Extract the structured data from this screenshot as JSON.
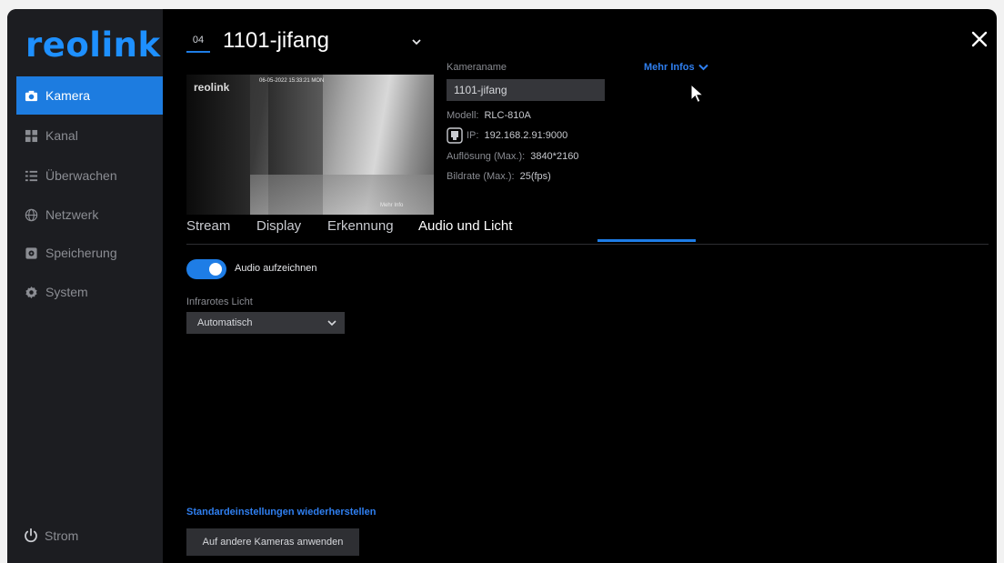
{
  "sidebar": {
    "logo": "reolink",
    "items": [
      {
        "label": "Kamera",
        "icon": "camera-icon",
        "active": true
      },
      {
        "label": "Kanal",
        "icon": "grid-icon"
      },
      {
        "label": "Überwachen",
        "icon": "list-icon"
      },
      {
        "label": "Netzwerk",
        "icon": "globe-icon"
      },
      {
        "label": "Speicherung",
        "icon": "storage-icon"
      },
      {
        "label": "System",
        "icon": "gear-icon"
      }
    ],
    "power_label": "Strom"
  },
  "header": {
    "channel_badge": "04",
    "camera_title": "1101-jifang"
  },
  "preview": {
    "logo_text": "reolink",
    "timestamp": "06-05-2022 15:33:21 MON",
    "overlay_name": "Mehr Info"
  },
  "info": {
    "kameraname_label": "Kameraname",
    "kameraname_value": "1101-jifang",
    "modell_label": "Modell:",
    "modell_value": "RLC-810A",
    "ip_label": "IP:",
    "ip_value": "192.168.2.91:9000",
    "aufloesung_label": "Auflösung (Max.):",
    "aufloesung_value": "3840*2160",
    "bildrate_label": "Bildrate (Max.):",
    "bildrate_value": "25(fps)",
    "mehr_infos": "Mehr Infos"
  },
  "tabs": [
    {
      "label": "Stream"
    },
    {
      "label": "Display"
    },
    {
      "label": "Erkennung"
    },
    {
      "label": "Audio und Licht",
      "active": true
    }
  ],
  "settings": {
    "audio_label": "Audio aufzeichnen",
    "audio_on": true,
    "ir_label": "Infrarotes Licht",
    "ir_value": "Automatisch"
  },
  "footer": {
    "reset_link": "Standardeinstellungen wiederherstellen",
    "apply_button": "Auf andere Kameras anwenden"
  },
  "colors": {
    "accent": "#1e7de6",
    "sidebar_bg": "#1c1d21",
    "content_bg": "#000000",
    "link": "#2f7ff0"
  }
}
